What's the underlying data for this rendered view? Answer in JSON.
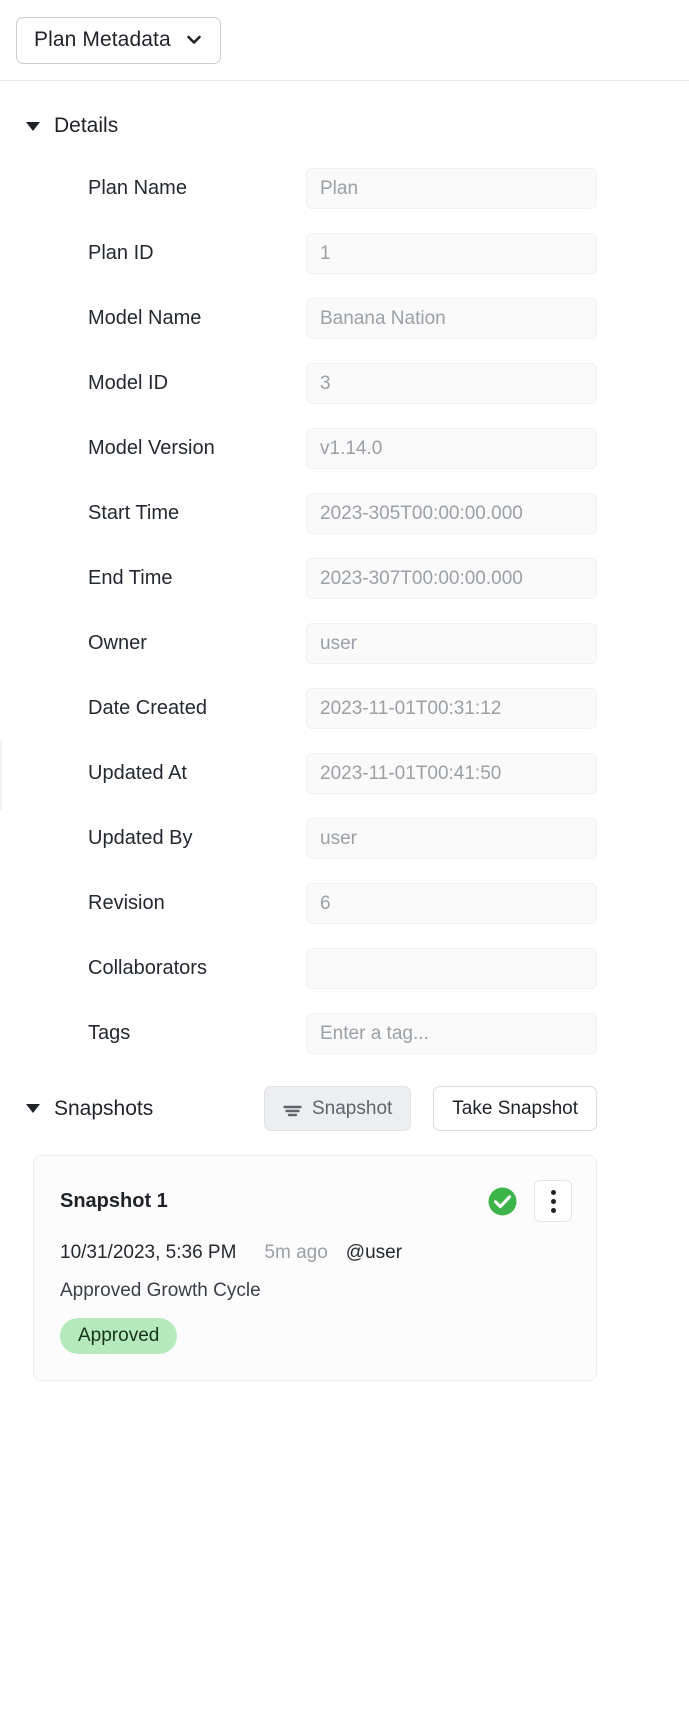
{
  "topbar": {
    "selector_label": "Plan Metadata",
    "chevron_icon": "chevron-down-icon"
  },
  "details": {
    "title": "Details",
    "caret_icon": "caret-down-icon",
    "rows": [
      {
        "label": "Plan Name",
        "value": "Plan"
      },
      {
        "label": "Plan ID",
        "value": "1"
      },
      {
        "label": "Model Name",
        "value": "Banana Nation"
      },
      {
        "label": "Model ID",
        "value": "3"
      },
      {
        "label": "Model Version",
        "value": "v1.14.0"
      },
      {
        "label": "Start Time",
        "value": "2023-305T00:00:00.000"
      },
      {
        "label": "End Time",
        "value": "2023-307T00:00:00.000"
      },
      {
        "label": "Owner",
        "value": "user"
      },
      {
        "label": "Date Created",
        "value": "2023-11-01T00:31:12"
      },
      {
        "label": "Updated At",
        "value": "2023-11-01T00:41:50"
      },
      {
        "label": "Updated By",
        "value": "user"
      },
      {
        "label": "Revision",
        "value": "6"
      },
      {
        "label": "Collaborators",
        "value": ""
      },
      {
        "label": "Tags",
        "value": "Enter a tag..."
      }
    ]
  },
  "snapshots": {
    "title": "Snapshots",
    "caret_icon": "caret-down-icon",
    "filter_button": {
      "label": "Snapshot",
      "icon": "filter-icon"
    },
    "take_button": {
      "label": "Take Snapshot"
    },
    "items": [
      {
        "title": "Snapshot 1",
        "status_icon": "check-circle-icon",
        "menu_icon": "kebab-menu-icon",
        "date": "10/31/2023, 5:36 PM",
        "relative": "5m ago",
        "user": "@user",
        "description": "Approved Growth Cycle",
        "badge": "Approved"
      }
    ]
  },
  "colors": {
    "check_green": "#3cb44a",
    "badge_bg": "#b6eabc",
    "field_bg": "#fafafa",
    "filter_bg": "#eceef0"
  }
}
